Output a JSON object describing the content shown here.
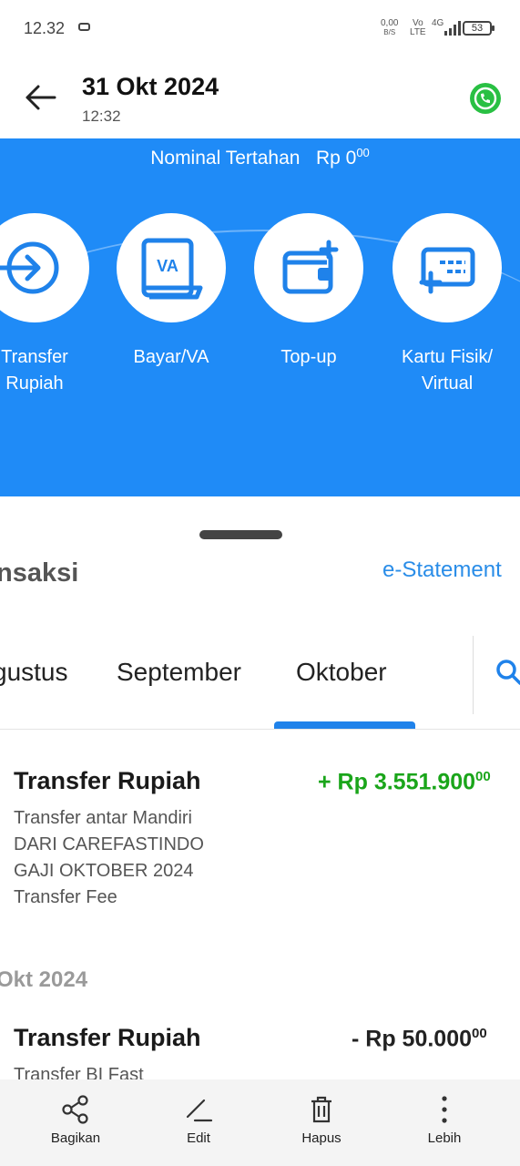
{
  "status_bar": {
    "time": "12.32",
    "speed_value": "0,00",
    "speed_unit": "B/S",
    "volte_top": "Vo",
    "volte_bottom": "LTE",
    "network": "4G",
    "battery": "53"
  },
  "header": {
    "title": "31 Okt 2024",
    "subtitle": "12:32",
    "back_icon": "arrow-left-icon",
    "app_icon": "whatsapp-icon"
  },
  "banner": {
    "nominal_label": "Nominal Tertahan",
    "nominal_value": "Rp 0",
    "nominal_sup": "00",
    "services": [
      {
        "line1": "Transfer",
        "line2": "Rupiah",
        "icon": "transfer-icon"
      },
      {
        "line1": "Bayar/VA",
        "line2": "",
        "icon": "va-icon"
      },
      {
        "line1": "Top-up",
        "line2": "",
        "icon": "wallet-icon"
      },
      {
        "line1": "Kartu Fisik/",
        "line2": "Virtual",
        "icon": "card-icon"
      }
    ],
    "colors": {
      "background": "#1f8bf7",
      "icon": "#1f82ea"
    }
  },
  "sheet": {
    "section_title": "nsaksi",
    "estatement_link": "e-Statement",
    "months": [
      "gustus",
      "September",
      "Oktober"
    ],
    "active_month": "Oktober",
    "search_icon": "search-icon"
  },
  "transactions": [
    {
      "title": "Transfer Rupiah",
      "amount": "+ Rp 3.551.900",
      "amount_sup": "00",
      "amount_color": "#1aa51a",
      "details": [
        "Transfer antar Mandiri",
        "DARI CAREFASTINDO",
        "GAJI OKTOBER 2024",
        "Transfer Fee"
      ]
    },
    {
      "date_header": "Okt 2024",
      "title": "Transfer Rupiah",
      "amount": "- Rp 50.000",
      "amount_sup": "00",
      "amount_color": "#222222",
      "details": [
        "Transfer BI Fast"
      ]
    }
  ],
  "bottom_bar": [
    {
      "label": "Bagikan",
      "icon": "share-icon"
    },
    {
      "label": "Edit",
      "icon": "edit-icon"
    },
    {
      "label": "Hapus",
      "icon": "trash-icon"
    },
    {
      "label": "Lebih",
      "icon": "more-vertical-icon"
    }
  ]
}
